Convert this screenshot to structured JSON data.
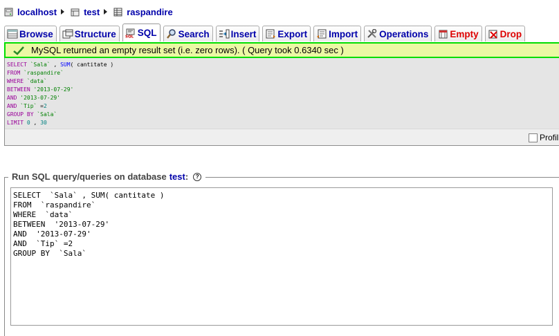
{
  "breadcrumb": {
    "server": "localhost",
    "database": "test",
    "table": "raspandire"
  },
  "tabs": [
    {
      "label": "Browse",
      "icon": "browse-icon"
    },
    {
      "label": "Structure",
      "icon": "structure-icon"
    },
    {
      "label": "SQL",
      "icon": "sql-icon",
      "active": true
    },
    {
      "label": "Search",
      "icon": "search-icon"
    },
    {
      "label": "Insert",
      "icon": "insert-icon"
    },
    {
      "label": "Export",
      "icon": "export-icon"
    },
    {
      "label": "Import",
      "icon": "import-icon"
    },
    {
      "label": "Operations",
      "icon": "operations-icon"
    },
    {
      "label": "Empty",
      "icon": "empty-icon"
    },
    {
      "label": "Drop",
      "icon": "drop-icon"
    }
  ],
  "result": {
    "message": "MySQL returned an empty result set (i.e. zero rows). ( Query took 0.6340 sec )",
    "sql_lines": [
      [
        [
          "kw",
          "SELECT "
        ],
        [
          "str",
          "`Sala`"
        ],
        [
          "plain",
          " , "
        ],
        [
          "fn",
          "SUM"
        ],
        [
          "plain",
          "( cantitate )"
        ]
      ],
      [
        [
          "kw",
          "FROM "
        ],
        [
          "str",
          "`raspandire`"
        ]
      ],
      [
        [
          "kw",
          "WHERE "
        ],
        [
          "str",
          "`data`"
        ]
      ],
      [
        [
          "kw",
          "BETWEEN "
        ],
        [
          "str",
          "'2013-07-29'"
        ]
      ],
      [
        [
          "kw",
          "AND "
        ],
        [
          "str",
          "'2013-07-29'"
        ]
      ],
      [
        [
          "kw",
          "AND "
        ],
        [
          "str",
          "`Tip`"
        ],
        [
          "plain",
          " ="
        ],
        [
          "num",
          "2"
        ]
      ],
      [
        [
          "kw",
          "GROUP BY "
        ],
        [
          "str",
          "`Sala`"
        ]
      ],
      [
        [
          "kw",
          "LIMIT "
        ],
        [
          "num",
          "0"
        ],
        [
          "plain",
          " , "
        ],
        [
          "num",
          "30"
        ]
      ]
    ],
    "profiling_label": "Profil"
  },
  "query_form": {
    "legend_prefix": "Run SQL query/queries on database",
    "database": "test",
    "legend_suffix": ":",
    "help_icon": "help-icon",
    "query_lines": [
      "SELECT  `Sala` , SUM( cantitate )",
      "FROM  `raspandire`",
      "WHERE  `data`",
      "BETWEEN  '2013-07-29'",
      "AND  '2013-07-29'",
      "AND  `Tip` =2",
      "GROUP BY  `Sala`"
    ]
  },
  "colors": {
    "link": "#0000aa",
    "danger": "#dd0000",
    "success_border": "#00dd00",
    "success_bg": "#ebf8a4"
  }
}
